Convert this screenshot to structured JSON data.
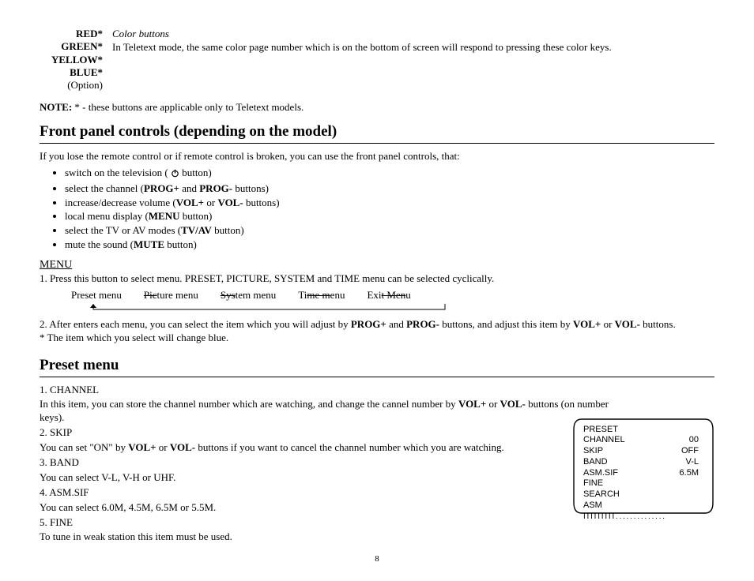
{
  "topLeft": {
    "red": "RED*",
    "green": "GREEN*",
    "yellow": "YELLOW*",
    "blue": "BLUE*",
    "option": "(Option)"
  },
  "topRight": {
    "title": "Color buttons",
    "text": "In Teletext mode, the same color page number which is on the bottom of screen will respond to pressing these color keys."
  },
  "note": {
    "label": "NOTE:",
    "text": " * - these buttons are applicable only to Teletext models."
  },
  "frontPanel": {
    "heading": "Front panel controls (depending on the model)",
    "intro": "If you lose the remote control or if remote control is broken, you can use the front panel controls, that:",
    "b1a": "switch on the television ( ",
    "b1b": " button)",
    "b2a": "select the channel (",
    "b2b": "PROG+",
    "b2c": " and ",
    "b2d": "PROG-",
    "b2e": " buttons)",
    "b3a": "increase/decrease volume (",
    "b3b": "VOL+",
    "b3c": " or ",
    "b3d": "VOL-",
    "b3e": " buttons)",
    "b4a": "local menu display (",
    "b4b": "MENU",
    "b4c": " button)",
    "b5a": "select the TV or AV modes (",
    "b5b": "TV/AV",
    "b5c": " button)",
    "b6a": "mute the sound (",
    "b6b": "MUTE",
    "b6c": " button)"
  },
  "menu": {
    "heading": "MENU",
    "line1": "1. Press this button to select menu. PRESET, PICTURE, SYSTEM and TIME menu can be selected cyclically.",
    "m1": "Preset menu",
    "m2a": "Pic",
    "m2b": "ture menu",
    "m3a": "Sys",
    "m3b": "tem menu",
    "m4a": "Ti",
    "m4b": "me m",
    "m4c": "enu",
    "m5a": "Exi",
    "m5b": "t Men",
    "m5c": "u",
    "line2a": "2. After enters each menu, you can select the item which you will adjust by ",
    "line2b": "PROG+",
    "line2c": " and ",
    "line2d": "PROG-",
    "line2e": " buttons, and adjust this item by ",
    "line2f": "VOL+",
    "line2g": " or ",
    "line2h": "VOL-",
    "line2i": " buttons.",
    "line3": "* The item which you select will change blue."
  },
  "preset": {
    "heading": "Preset menu",
    "p1": "1. CHANNEL",
    "p1ta": "In this item, you can store the channel number which are watching, and change the cannel number by ",
    "p1tb": "VOL+",
    "p1tc": " or ",
    "p1td": "VOL-",
    "p1te": " buttons (on number keys).",
    "p2": "2. SKIP",
    "p2ta": "You can set \"ON\" by ",
    "p2tb": "VOL+",
    "p2tc": " or ",
    "p2td": "VOL-",
    "p2te": " buttons if you want to cancel the channel number which you are watching.",
    "p3": "3. BAND",
    "p3t": "You can select V-L, V-H or UHF.",
    "p4": "4. ASM.SIF",
    "p4t": "You can select 6.0M, 4.5M, 6.5M or 5.5M.",
    "p5": "5. FINE",
    "p5t": "To tune in weak station this item must be used."
  },
  "tv": {
    "title": "PRESET",
    "r1k": "CHANNEL",
    "r1v": "00",
    "r2k": "SKIP",
    "r2v": "OFF",
    "r3k": "BAND",
    "r3v": "V-L",
    "r4k": "ASM.SIF",
    "r4v": "6.5M",
    "r5k": "FINE",
    "r6k": "SEARCH",
    "r7k": "ASM",
    "bar": "I I I I I I I I I . . . . . . . . . . . . . ."
  },
  "pageNumber": "8"
}
